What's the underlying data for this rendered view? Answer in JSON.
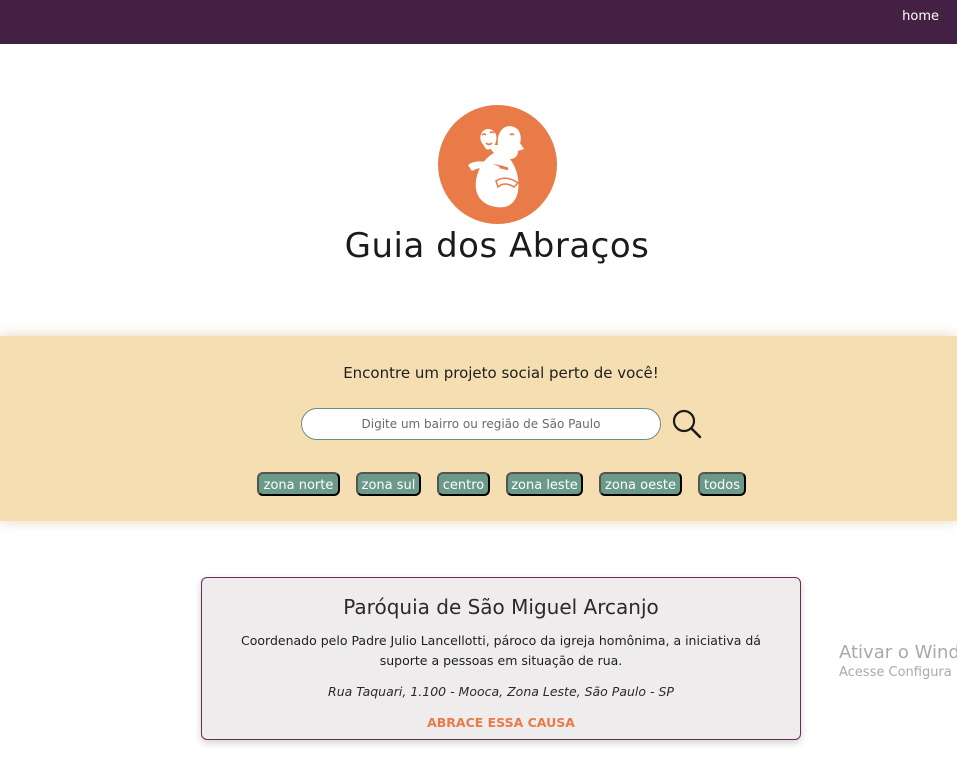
{
  "nav": {
    "home_label": "home"
  },
  "brand": {
    "title": "Guia dos Abraços",
    "logo_icon": "hug-logo-icon",
    "logo_color": "#e87b47"
  },
  "search": {
    "prompt": "Encontre um projeto social perto de você!",
    "placeholder": "Digite um bairro ou região de São Paulo",
    "icon": "search-icon"
  },
  "filters": [
    "zona norte",
    "zona sul",
    "centro",
    "zona leste",
    "zona oeste",
    "todos"
  ],
  "projects": [
    {
      "title": "Paróquia de São Miguel Arcanjo",
      "description": "Coordenado pelo Padre Julio Lancellotti, pároco da igreja homônima, a iniciativa dá suporte a pessoas em situação de rua.",
      "address": "Rua Taquari, 1.100 - Mooca, Zona Leste, São Paulo - SP",
      "cta": "ABRACE ESSA CAUSA"
    }
  ],
  "os_watermark": {
    "title": "Ativar o Wind",
    "subtitle": "Acesse Configura"
  },
  "colors": {
    "topbar": "#432044",
    "band": "#f5dfb2",
    "chip": "#6b9a89",
    "accent": "#e87b47",
    "card_border": "#6e2b55"
  }
}
